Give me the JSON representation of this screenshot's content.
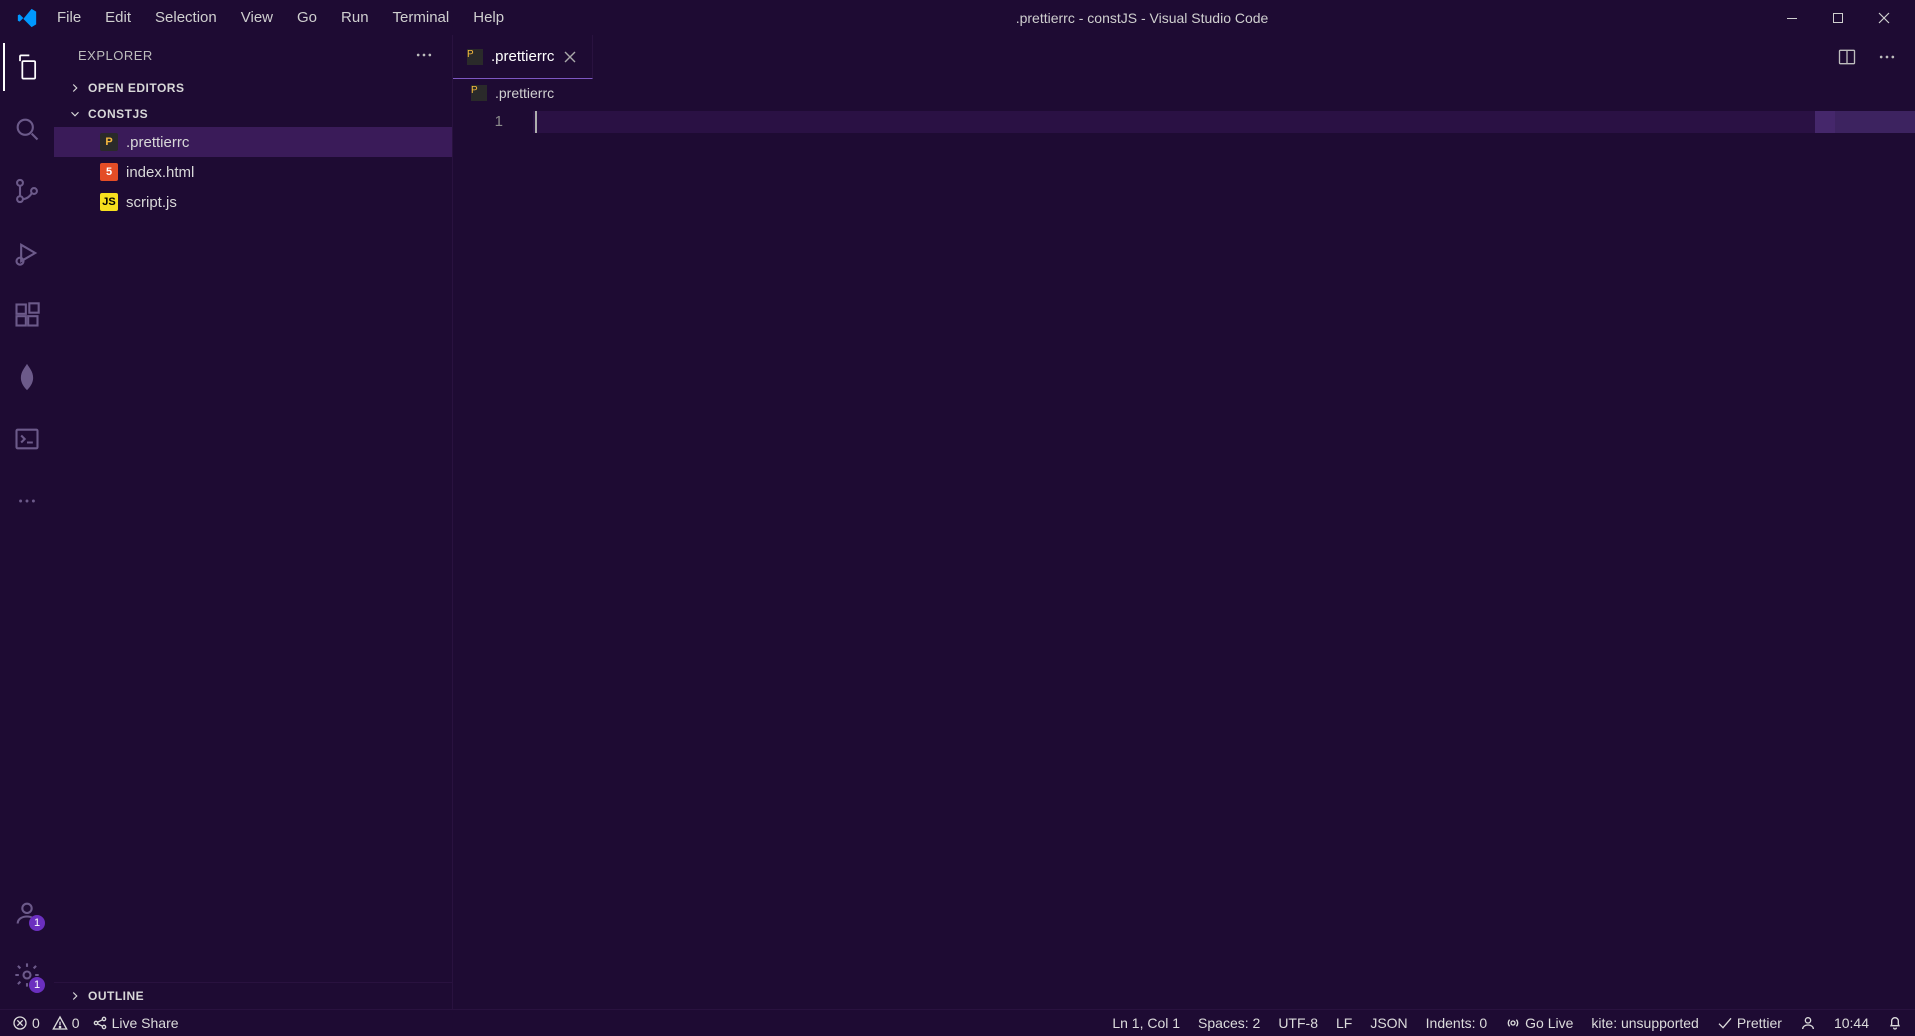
{
  "titlebar": {
    "menus": [
      "File",
      "Edit",
      "Selection",
      "View",
      "Go",
      "Run",
      "Terminal",
      "Help"
    ],
    "title": ".prettierrc - constJS - Visual Studio Code"
  },
  "sidebar": {
    "title": "EXPLORER",
    "sections": {
      "open_editors": {
        "label": "OPEN EDITORS",
        "expanded": false
      },
      "folder": {
        "label": "CONSTJS",
        "expanded": true
      },
      "outline": {
        "label": "OUTLINE",
        "expanded": false
      }
    },
    "files": [
      {
        "name": ".prettierrc",
        "icon": "prettier",
        "selected": true
      },
      {
        "name": "index.html",
        "icon": "html",
        "selected": false
      },
      {
        "name": "script.js",
        "icon": "js",
        "selected": false
      }
    ]
  },
  "activity": {
    "accounts_badge": "1",
    "settings_badge": "1"
  },
  "editor": {
    "tab_label": ".prettierrc",
    "breadcrumb": ".prettierrc",
    "line_numbers": [
      "1"
    ]
  },
  "statusbar": {
    "errors": "0",
    "warnings": "0",
    "live_share": "Live Share",
    "cursor": "Ln 1, Col 1",
    "spaces": "Spaces: 2",
    "encoding": "UTF-8",
    "eol": "LF",
    "language": "JSON",
    "indents": "Indents: 0",
    "go_live": "Go Live",
    "kite": "kite: unsupported",
    "prettier": "Prettier",
    "clock": "10:44"
  }
}
